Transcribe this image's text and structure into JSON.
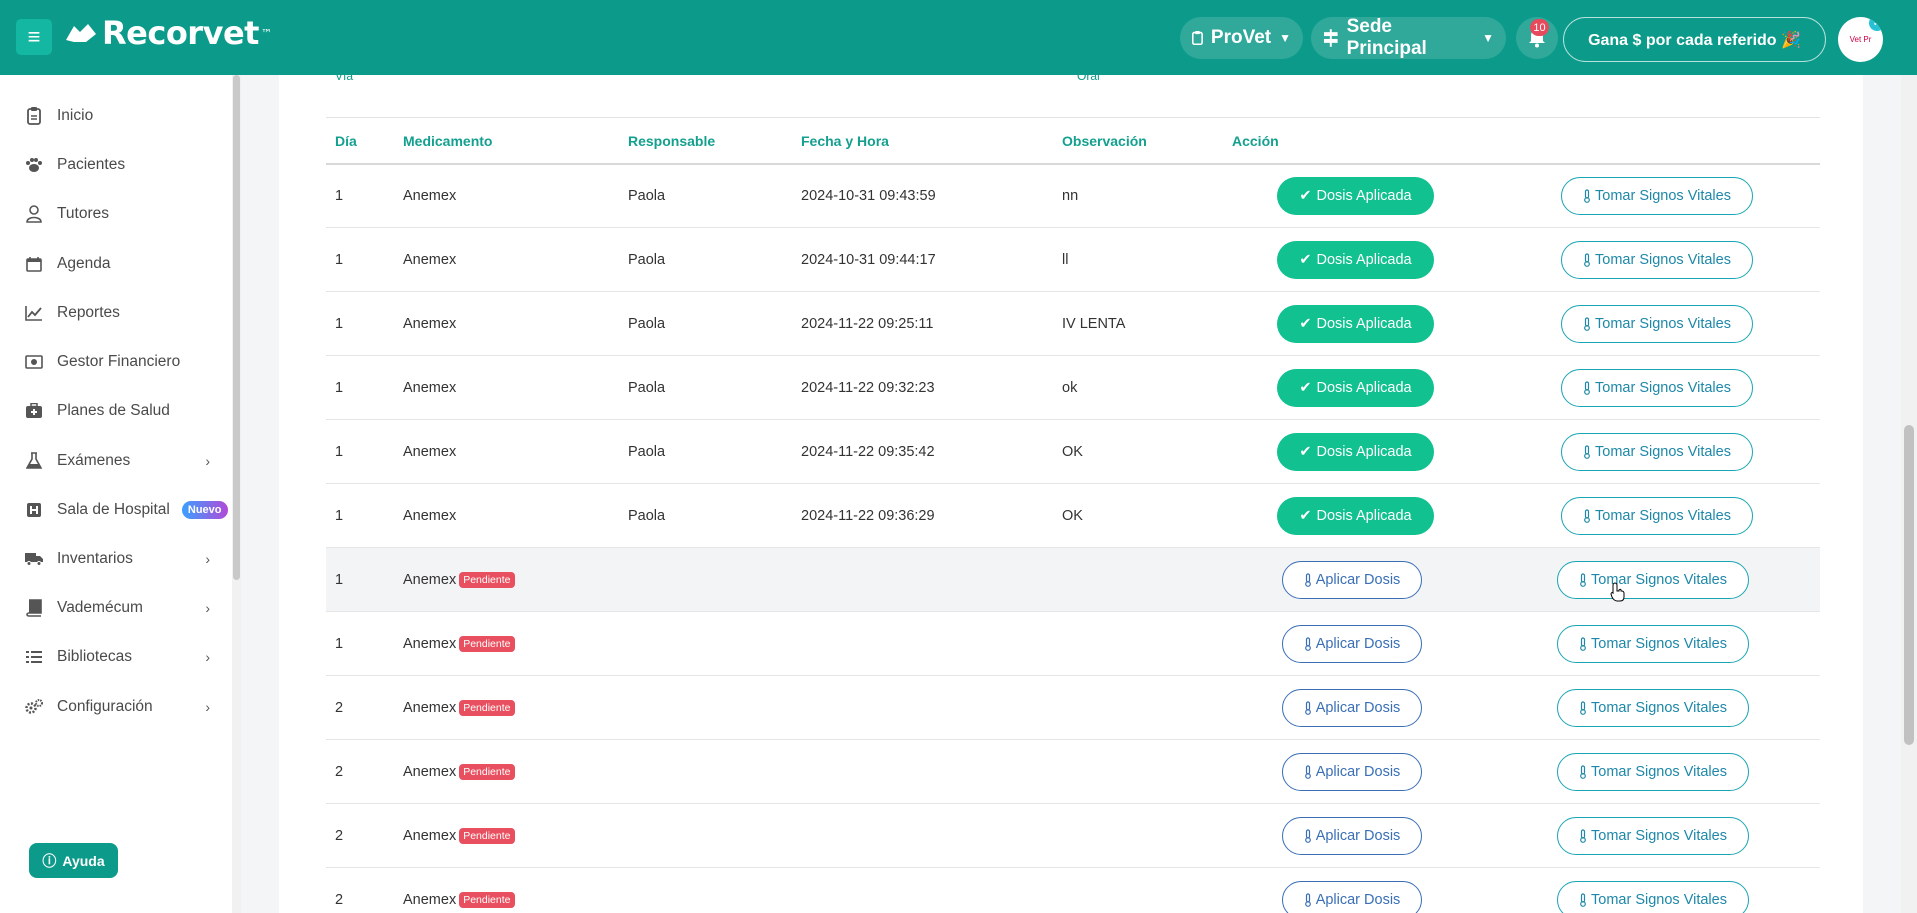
{
  "header": {
    "logo_text": "Recorvet",
    "logo_tm": "™",
    "org_selector": "ProVet",
    "branch_selector": "Sede Principal",
    "notification_count": "10",
    "referral_button": "Gana $ por cada referido 🎉",
    "avatar_text": "Vet Pr",
    "brand_color": "#0c9b8a"
  },
  "sidebar": {
    "items": [
      {
        "label": "Inicio",
        "icon": "clipboard-icon"
      },
      {
        "label": "Pacientes",
        "icon": "paw-icon"
      },
      {
        "label": "Tutores",
        "icon": "user-icon"
      },
      {
        "label": "Agenda",
        "icon": "calendar-icon"
      },
      {
        "label": "Reportes",
        "icon": "line-chart-icon"
      },
      {
        "label": "Gestor Financiero",
        "icon": "money-icon"
      },
      {
        "label": "Planes de Salud",
        "icon": "medkit-icon"
      },
      {
        "label": "Exámenes",
        "icon": "flask-icon"
      },
      {
        "label": "Sala de Hospital",
        "icon": "hospital-icon",
        "badge": "Nuevo"
      },
      {
        "label": "Inventarios",
        "icon": "truck-icon"
      },
      {
        "label": "Vademécum",
        "icon": "book-icon"
      },
      {
        "label": "Bibliotecas",
        "icon": "list-icon"
      },
      {
        "label": "Configuración",
        "icon": "gears-icon"
      }
    ],
    "help_button": "Ayuda"
  },
  "table": {
    "cut_labels": [
      "Vía",
      "Oral"
    ],
    "columns": [
      "Día",
      "Medicamento",
      "Responsable",
      "Fecha y Hora",
      "Observación",
      "Acción"
    ],
    "rows": [
      {
        "dia": "1",
        "medicamento": "Anemex",
        "responsable": "Paola",
        "fecha": "2024-10-31 09:43:59",
        "observacion": "nn",
        "status": "applied"
      },
      {
        "dia": "1",
        "medicamento": "Anemex",
        "responsable": "Paola",
        "fecha": "2024-10-31 09:44:17",
        "observacion": "ll",
        "status": "applied"
      },
      {
        "dia": "1",
        "medicamento": "Anemex",
        "responsable": "Paola",
        "fecha": "2024-11-22 09:25:11",
        "observacion": "IV LENTA",
        "status": "applied"
      },
      {
        "dia": "1",
        "medicamento": "Anemex",
        "responsable": "Paola",
        "fecha": "2024-11-22 09:32:23",
        "observacion": "ok",
        "status": "applied"
      },
      {
        "dia": "1",
        "medicamento": "Anemex",
        "responsable": "Paola",
        "fecha": "2024-11-22 09:35:42",
        "observacion": "OK",
        "status": "applied"
      },
      {
        "dia": "1",
        "medicamento": "Anemex",
        "responsable": "Paola",
        "fecha": "2024-11-22 09:36:29",
        "observacion": "OK",
        "status": "applied"
      },
      {
        "dia": "1",
        "medicamento": "Anemex",
        "responsable": "",
        "fecha": "",
        "observacion": "",
        "status": "pending"
      },
      {
        "dia": "1",
        "medicamento": "Anemex",
        "responsable": "",
        "fecha": "",
        "observacion": "",
        "status": "pending"
      },
      {
        "dia": "2",
        "medicamento": "Anemex",
        "responsable": "",
        "fecha": "",
        "observacion": "",
        "status": "pending"
      },
      {
        "dia": "2",
        "medicamento": "Anemex",
        "responsable": "",
        "fecha": "",
        "observacion": "",
        "status": "pending"
      },
      {
        "dia": "2",
        "medicamento": "Anemex",
        "responsable": "",
        "fecha": "",
        "observacion": "",
        "status": "pending"
      },
      {
        "dia": "2",
        "medicamento": "Anemex",
        "responsable": "",
        "fecha": "",
        "observacion": "",
        "status": "pending"
      }
    ],
    "labels": {
      "applied": "Dosis Aplicada",
      "apply": "Aplicar Dosis",
      "vitals": "Tomar Signos Vitales",
      "pending": "Pendiente"
    },
    "colors": {
      "applied_green": "#12c190",
      "pending_red": "#e8505f",
      "vitals_teal": "#1aa5b4"
    }
  }
}
